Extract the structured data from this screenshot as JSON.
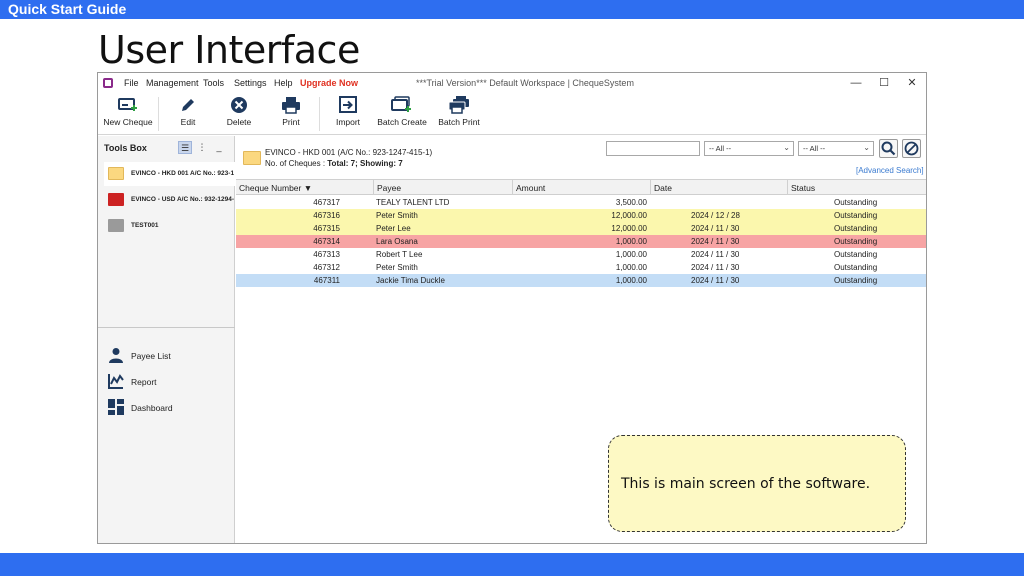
{
  "slide": {
    "header_label": "Quick Start Guide",
    "title": "User Interface",
    "callout_text": "This is main screen of the software."
  },
  "colors": {
    "slide_bar": "#2e6ef0",
    "row_yellow": "#fbf7ad",
    "row_red": "#f7a4a4",
    "row_blue": "#c3ddf6",
    "upgrade_text": "#e03020",
    "folder_yellow": "#fbd880",
    "folder_red": "#cc2222",
    "folder_gray": "#9a9a9a",
    "icon_navy": "#1f3a5f"
  },
  "window": {
    "title": "***Trial Version*** Default Workspace | ChequeSystem",
    "menu": [
      "File",
      "Management",
      "Tools",
      "Settings",
      "Help"
    ],
    "upgrade_label": "Upgrade Now",
    "controls": [
      "—",
      "☐",
      "✕"
    ]
  },
  "toolbar": [
    {
      "label": "New Cheque",
      "icon": "new-cheque-icon"
    },
    {
      "label": "Edit",
      "icon": "pencil-icon"
    },
    {
      "label": "Delete",
      "icon": "delete-circle-icon"
    },
    {
      "label": "Print",
      "icon": "printer-icon"
    },
    {
      "label": "Import",
      "icon": "import-icon"
    },
    {
      "label": "Batch Create",
      "icon": "batch-create-icon"
    },
    {
      "label": "Batch Print",
      "icon": "batch-print-icon"
    }
  ],
  "tools_box": {
    "title": "Tools Box",
    "view_buttons": [
      "☰",
      "⋮",
      "_"
    ],
    "accounts": [
      {
        "label": "EVINCO - HKD 001 A/C No.: 923-1",
        "icon": "folder-yellow-icon"
      },
      {
        "label": "EVINCO - USD A/C No.: 932-1294-",
        "icon": "folder-red-icon"
      },
      {
        "label": "TEST001",
        "icon": "folder-gray-icon"
      }
    ],
    "nav": [
      {
        "label": "Payee List",
        "icon": "person-icon"
      },
      {
        "label": "Report",
        "icon": "chart-icon"
      },
      {
        "label": "Dashboard",
        "icon": "dashboard-icon"
      }
    ]
  },
  "account_header": {
    "name": "EVINCO - HKD 001 (A/C No.: 923-1247-415-1)",
    "count_prefix": "No. of Cheques : ",
    "count_value": "Total: 7; Showing: 7"
  },
  "search": {
    "value": "",
    "filter1": "-- All --",
    "filter2": "-- All --",
    "advanced_label": "[Advanced Search]"
  },
  "table": {
    "columns": [
      "Cheque Number ▼",
      "Payee",
      "Amount",
      "Date",
      "Status"
    ],
    "rows": [
      {
        "number": "467317",
        "payee": "TEALY TALENT LTD",
        "amount": "3,500.00",
        "date": "",
        "status": "Outstanding",
        "highlight": "none"
      },
      {
        "number": "467316",
        "payee": "Peter Smith",
        "amount": "12,000.00",
        "date": "2024 / 12 / 28",
        "status": "Outstanding",
        "highlight": "yellow"
      },
      {
        "number": "467315",
        "payee": "Peter Lee",
        "amount": "12,000.00",
        "date": "2024 / 11 / 30",
        "status": "Outstanding",
        "highlight": "yellow"
      },
      {
        "number": "467314",
        "payee": "Lara Osana",
        "amount": "1,000.00",
        "date": "2024 / 11 / 30",
        "status": "Outstanding",
        "highlight": "red"
      },
      {
        "number": "467313",
        "payee": "Robert T Lee",
        "amount": "1,000.00",
        "date": "2024 / 11 / 30",
        "status": "Outstanding",
        "highlight": "none"
      },
      {
        "number": "467312",
        "payee": "Peter Smith",
        "amount": "1,000.00",
        "date": "2024 / 11 / 30",
        "status": "Outstanding",
        "highlight": "none"
      },
      {
        "number": "467311",
        "payee": "Jackie Tima Duckle",
        "amount": "1,000.00",
        "date": "2024 / 11 / 30",
        "status": "Outstanding",
        "highlight": "blue"
      }
    ]
  }
}
